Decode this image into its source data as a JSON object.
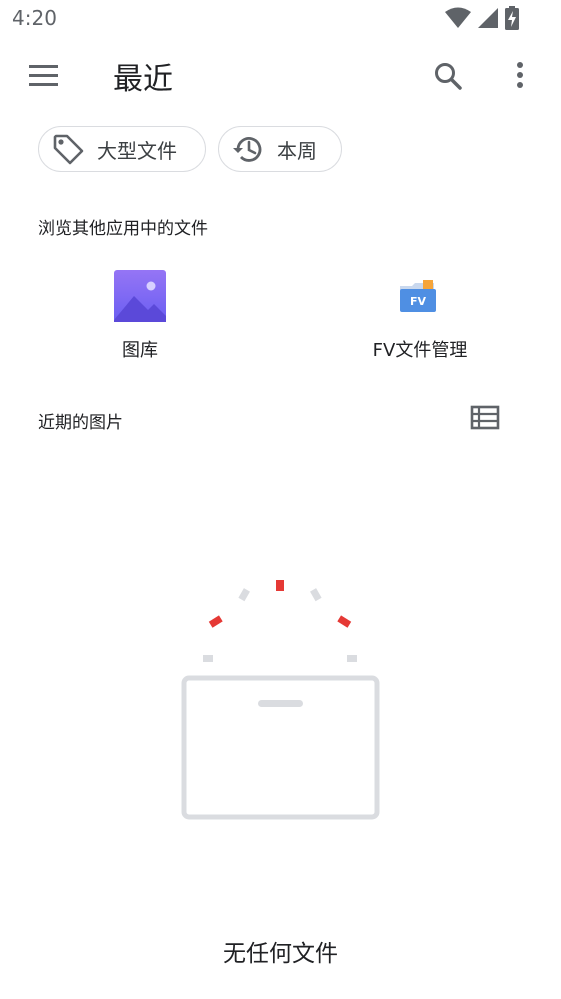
{
  "status_bar": {
    "time": "4:20",
    "icons": [
      "wifi-icon",
      "signal-icon",
      "battery-charging-icon"
    ]
  },
  "app_bar": {
    "title": "最近",
    "icons": [
      "menu-icon",
      "search-icon",
      "more-vert-icon"
    ]
  },
  "chips": [
    {
      "label": "大型文件",
      "icon": "tag-icon"
    },
    {
      "label": "本周",
      "icon": "history-icon"
    }
  ],
  "browse_section": {
    "label": "浏览其他应用中的文件",
    "apps": [
      {
        "label": "图库",
        "icon": "gallery-app-icon"
      },
      {
        "label": "FV文件管理",
        "icon": "fv-file-manager-icon",
        "icon_text": "FV"
      }
    ]
  },
  "recent_section": {
    "label": "近期的图片",
    "view_toggle_icon": "list-view-icon"
  },
  "empty_state": {
    "text": "无任何文件",
    "accent_color": "#e53935",
    "neutral_color": "#dadce0"
  }
}
